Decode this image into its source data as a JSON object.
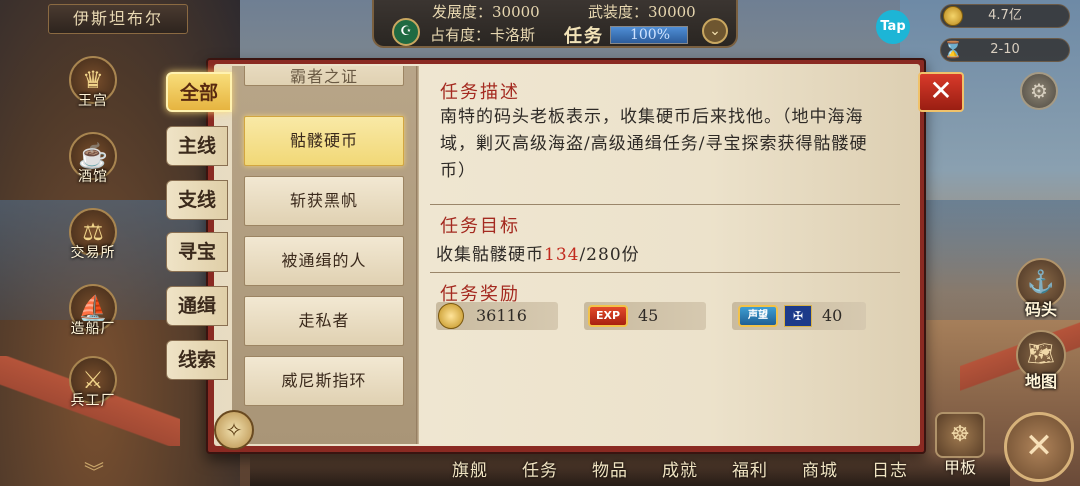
{
  "city": "伊斯坦布尔",
  "status": {
    "development": "发展度：30000",
    "armament": "武装度：30000",
    "occupancy": "占有度：卡洛斯",
    "title": "任务",
    "percent_text": "100%",
    "percent_value": 1.0
  },
  "top_right": {
    "tap_logo": "Tap",
    "gold": "4.7亿",
    "time": "2-10"
  },
  "left_menu": [
    {
      "label": "王宫",
      "icon": "crown-icon"
    },
    {
      "label": "酒馆",
      "icon": "mug-icon"
    },
    {
      "label": "交易所",
      "icon": "scales-icon"
    },
    {
      "label": "造船厂",
      "icon": "ship-icon"
    },
    {
      "label": "兵工厂",
      "icon": "cannon-icon"
    }
  ],
  "right_menu": [
    {
      "label": "码头",
      "icon": "dock-icon"
    },
    {
      "label": "地图",
      "icon": "map-icon"
    }
  ],
  "categories": [
    "全部",
    "主线",
    "支线",
    "寻宝",
    "通缉",
    "线索"
  ],
  "active_category": "全部",
  "quests": [
    "霸者之证",
    "骷髅硬币",
    "斩获黑帆",
    "被通缉的人",
    "走私者",
    "威尼斯指环"
  ],
  "selected_quest": "骷髅硬币",
  "detail": {
    "desc_title": "任务描述",
    "description": "南特的码头老板表示，收集硬币后来找他。（地中海海域，剿灭高级海盗/高级通缉任务/寻宝探索获得骷髅硬币）",
    "goal_title": "任务目标",
    "goal_prefix": "收集骷髅硬币",
    "goal_current": "134",
    "goal_suffix": "/280份",
    "reward_title": "任务奖励",
    "rewards": {
      "gold": "36116",
      "exp_label": "EXP",
      "exp": "45",
      "rep_label": "声望",
      "rep": "40"
    }
  },
  "bottom_nav": [
    "旗舰",
    "任务",
    "物品",
    "成就",
    "福利",
    "商城",
    "日志",
    "甲板"
  ],
  "colors": {
    "accent_red": "#a42a20",
    "highlight_gold": "#f1d877",
    "progress_red": "#c22a1e"
  }
}
